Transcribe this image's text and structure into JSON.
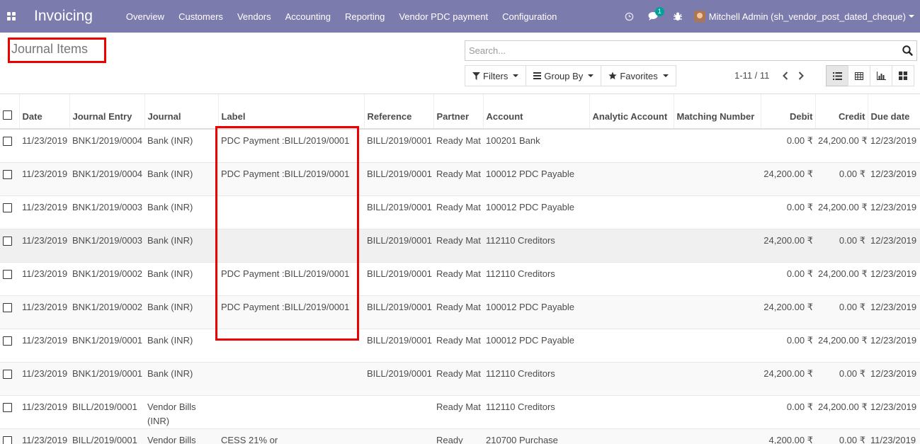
{
  "navbar": {
    "app_name": "Invoicing",
    "menu": [
      "Overview",
      "Customers",
      "Vendors",
      "Accounting",
      "Reporting",
      "Vendor PDC payment",
      "Configuration"
    ],
    "messages_badge": "1",
    "user_name": "Mitchell Admin (sh_vendor_post_dated_cheque)",
    "bg_color": "#7c7bad",
    "icons": [
      "apps-icon",
      "clock-icon",
      "chat-icon",
      "bug-icon",
      "avatar"
    ]
  },
  "control": {
    "title": "Journal Items",
    "search_placeholder": "Search...",
    "filters_label": "Filters",
    "group_by_label": "Group By",
    "favorites_label": "Favorites",
    "pager": "1-11 / 11",
    "views": [
      "list-view-icon",
      "pivot-view-icon",
      "graph-view-icon",
      "kanban-view-icon"
    ]
  },
  "table": {
    "headers": {
      "date": "Date",
      "journal_entry": "Journal Entry",
      "journal": "Journal",
      "label": "Label",
      "reference": "Reference",
      "partner": "Partner",
      "account": "Account",
      "analytic_account": "Analytic Account",
      "matching_number": "Matching Number",
      "debit": "Debit",
      "credit": "Credit",
      "due_date": "Due date"
    },
    "rows": [
      {
        "date": "11/23/2019",
        "entry": "BNK1/2019/0004",
        "journal": "Bank (INR)",
        "label": "PDC Payment :BILL/2019/0001",
        "reference": "BILL/2019/0001",
        "partner": "Ready Mat",
        "account": "100201 Bank",
        "analytic": "",
        "matching": "",
        "debit": "0.00 ₹",
        "credit": "24,200.00 ₹",
        "due": "12/23/2019"
      },
      {
        "date": "11/23/2019",
        "entry": "BNK1/2019/0004",
        "journal": "Bank (INR)",
        "label": "PDC Payment :BILL/2019/0001",
        "reference": "BILL/2019/0001",
        "partner": "Ready Mat",
        "account": "100012 PDC Payable",
        "analytic": "",
        "matching": "",
        "debit": "24,200.00 ₹",
        "credit": "0.00 ₹",
        "due": "12/23/2019"
      },
      {
        "date": "11/23/2019",
        "entry": "BNK1/2019/0003",
        "journal": "Bank (INR)",
        "label": "",
        "reference": "BILL/2019/0001",
        "partner": "Ready Mat",
        "account": "100012 PDC Payable",
        "analytic": "",
        "matching": "",
        "debit": "0.00 ₹",
        "credit": "24,200.00 ₹",
        "due": "12/23/2019"
      },
      {
        "date": "11/23/2019",
        "entry": "BNK1/2019/0003",
        "journal": "Bank (INR)",
        "label": "",
        "reference": "BILL/2019/0001",
        "partner": "Ready Mat",
        "account": "112110 Creditors",
        "analytic": "",
        "matching": "",
        "debit": "24,200.00 ₹",
        "credit": "0.00 ₹",
        "due": "12/23/2019"
      },
      {
        "date": "11/23/2019",
        "entry": "BNK1/2019/0002",
        "journal": "Bank (INR)",
        "label": "PDC Payment :BILL/2019/0001",
        "reference": "BILL/2019/0001",
        "partner": "Ready Mat",
        "account": "112110 Creditors",
        "analytic": "",
        "matching": "",
        "debit": "0.00 ₹",
        "credit": "24,200.00 ₹",
        "due": "12/23/2019"
      },
      {
        "date": "11/23/2019",
        "entry": "BNK1/2019/0002",
        "journal": "Bank (INR)",
        "label": "PDC Payment :BILL/2019/0001",
        "reference": "BILL/2019/0001",
        "partner": "Ready Mat",
        "account": "100012 PDC Payable",
        "analytic": "",
        "matching": "",
        "debit": "24,200.00 ₹",
        "credit": "0.00 ₹",
        "due": "12/23/2019"
      },
      {
        "date": "11/23/2019",
        "entry": "BNK1/2019/0001",
        "journal": "Bank (INR)",
        "label": "",
        "reference": "BILL/2019/0001",
        "partner": "Ready Mat",
        "account": "100012 PDC Payable",
        "analytic": "",
        "matching": "",
        "debit": "0.00 ₹",
        "credit": "24,200.00 ₹",
        "due": "12/23/2019"
      },
      {
        "date": "11/23/2019",
        "entry": "BNK1/2019/0001",
        "journal": "Bank (INR)",
        "label": "",
        "reference": "BILL/2019/0001",
        "partner": "Ready Mat",
        "account": "112110 Creditors",
        "analytic": "",
        "matching": "",
        "debit": "24,200.00 ₹",
        "credit": "0.00 ₹",
        "due": "12/23/2019"
      },
      {
        "date": "11/23/2019",
        "entry": "BILL/2019/0001",
        "journal": "Vendor Bills (INR)",
        "label": "",
        "reference": "",
        "partner": "Ready Mat",
        "account": "112110 Creditors",
        "analytic": "",
        "matching": "",
        "debit": "0.00 ₹",
        "credit": "24,200.00 ₹",
        "due": "12/23/2019"
      },
      {
        "date": "11/23/2019",
        "entry": "BILL/2019/0001",
        "journal": "Vendor Bills",
        "label": "CESS 21% or",
        "reference": "",
        "partner": "Ready",
        "account": "210700 Purchase",
        "analytic": "",
        "matching": "",
        "debit": "4,200.00 ₹",
        "credit": "0.00 ₹",
        "due": "11/23/2019"
      }
    ]
  }
}
